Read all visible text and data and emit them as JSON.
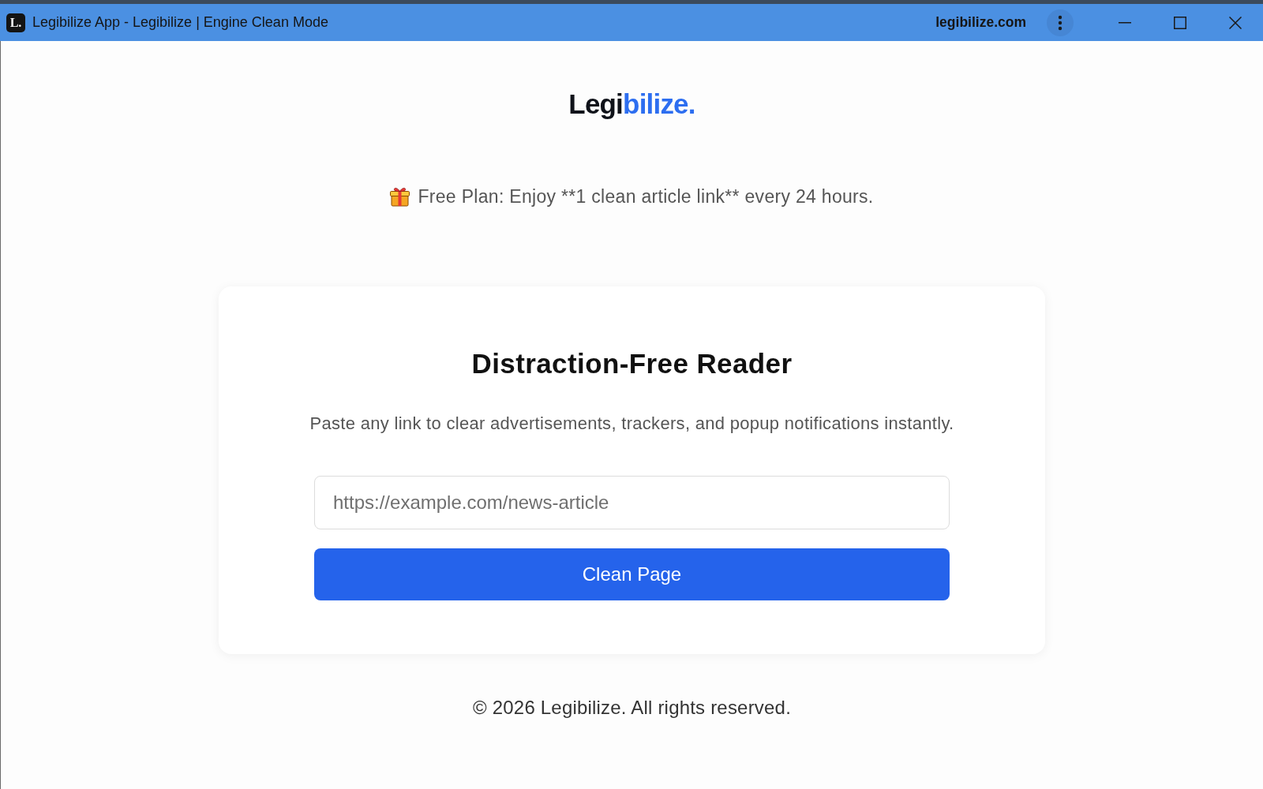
{
  "window": {
    "title": "Legibilize App - Legibilize | Engine Clean Mode",
    "icon_letter": "L.",
    "domain": "legibilize.com"
  },
  "logo": {
    "text": "Legi",
    "accent": "bilize."
  },
  "notice": {
    "text": "Free Plan: Enjoy **1 clean article link** every 24 hours."
  },
  "card": {
    "title": "Distraction-Free Reader",
    "description": "Paste any link to clear advertisements, trackers, and popup notifications instantly.",
    "url_field": {
      "placeholder": "https://example.com/news-article"
    },
    "button": "Clean Page"
  },
  "footer": {
    "text": "© 2026 Legibilize. All rights reserved."
  }
}
